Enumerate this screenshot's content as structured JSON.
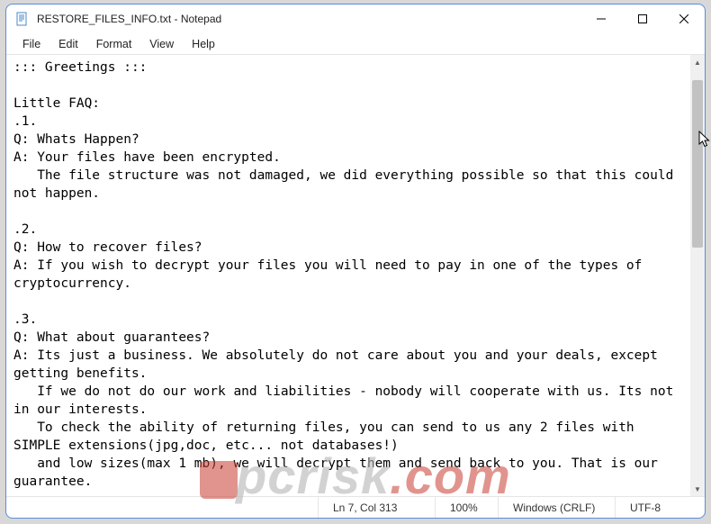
{
  "title": "RESTORE_FILES_INFO.txt - Notepad",
  "menu": {
    "items": [
      "File",
      "Edit",
      "Format",
      "View",
      "Help"
    ]
  },
  "body": "::: Greetings :::\n\nLittle FAQ:\n.1.\nQ: Whats Happen?\nA: Your files have been encrypted.\n   The file structure was not damaged, we did everything possible so that this could not happen.\n\n.2.\nQ: How to recover files?\nA: If you wish to decrypt your files you will need to pay in one of the types of cryptocurrency.\n\n.3.\nQ: What about guarantees?\nA: Its just a business. We absolutely do not care about you and your deals, except getting benefits.\n   If we do not do our work and liabilities - nobody will cooperate with us. Its not in our interests.\n   To check the ability of returning files, you can send to us any 2 files with SIMPLE extensions(jpg,doc, etc... not databases!)\n   and low sizes(max 1 mb), we will decrypt them and send back to you. That is our guarantee.",
  "status": {
    "ln_col": "Ln 7, Col 313",
    "zoom": "100%",
    "eol": "Windows (CRLF)",
    "enc": "UTF-8"
  },
  "watermark": {
    "left": "pcrisk",
    "right": ".com"
  }
}
